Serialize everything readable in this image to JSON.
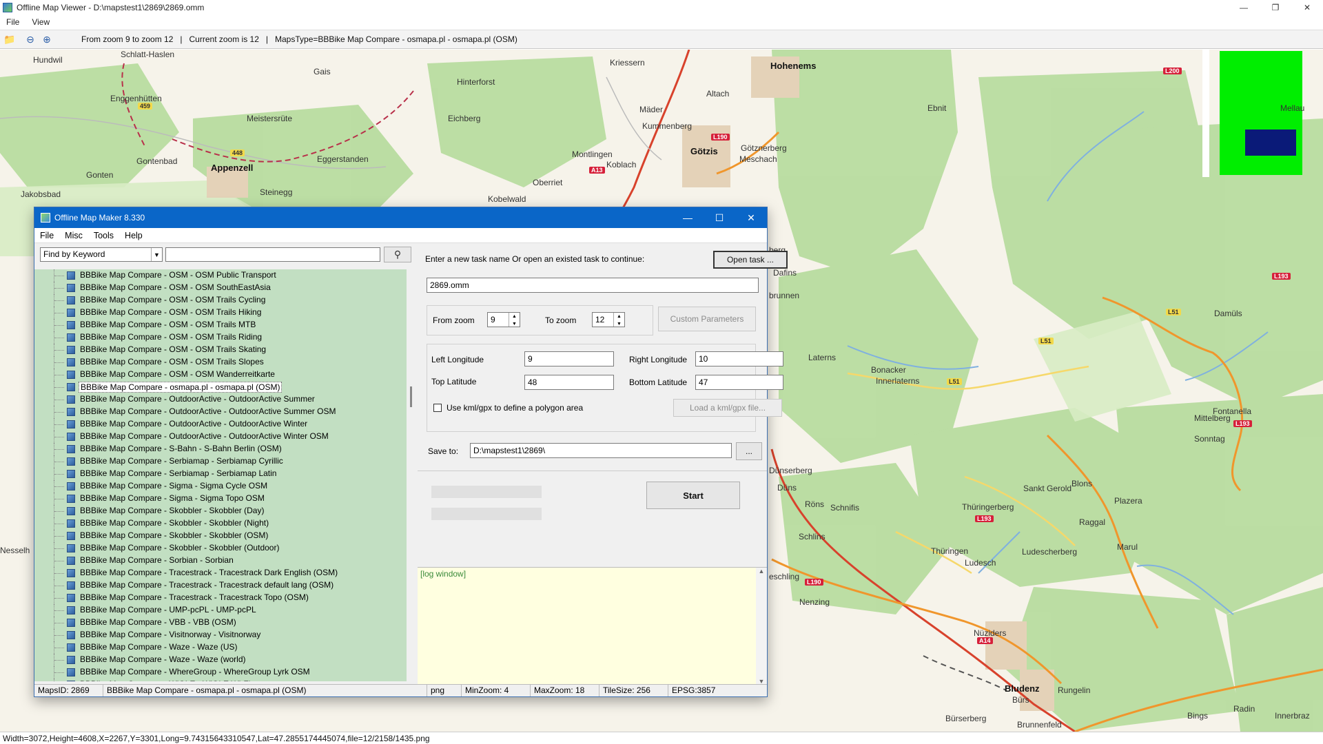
{
  "window": {
    "title": "Offline Map Viewer - D:\\mapstest1\\2869\\2869.omm"
  },
  "menu": [
    "File",
    "View"
  ],
  "toolbar": {
    "zoom_range": "From zoom 9 to zoom 12",
    "current_zoom": "Current zoom is 12",
    "maps_type": "MapsType=BBBike Map Compare - osmapa.pl - osmapa.pl (OSM)"
  },
  "map": {
    "places": [
      {
        "name": "Hundwil",
        "kind": "village"
      },
      {
        "name": "Schlatt-Haslen",
        "kind": "village"
      },
      {
        "name": "Gais",
        "kind": "village"
      },
      {
        "name": "Hinterforst",
        "kind": "village"
      },
      {
        "name": "Kriessern",
        "kind": "village"
      },
      {
        "name": "Hohenems",
        "kind": "town"
      },
      {
        "name": "Enggenhütten",
        "kind": "village"
      },
      {
        "name": "Meistersrüte",
        "kind": "village"
      },
      {
        "name": "Eichberg",
        "kind": "village"
      },
      {
        "name": "Altach",
        "kind": "village"
      },
      {
        "name": "Mäder",
        "kind": "village"
      },
      {
        "name": "Kummenberg",
        "kind": "village"
      },
      {
        "name": "Ebnit",
        "kind": "village"
      },
      {
        "name": "Mellau",
        "kind": "village"
      },
      {
        "name": "Gontenbad",
        "kind": "village"
      },
      {
        "name": "Eggerstanden",
        "kind": "village"
      },
      {
        "name": "Appenzell",
        "kind": "town"
      },
      {
        "name": "Montlingen",
        "kind": "village"
      },
      {
        "name": "Koblach",
        "kind": "village"
      },
      {
        "name": "Götzis",
        "kind": "town"
      },
      {
        "name": "Götznerberg",
        "kind": "village"
      },
      {
        "name": "Meschach",
        "kind": "village"
      },
      {
        "name": "Gonten",
        "kind": "village"
      },
      {
        "name": "Jakobsbad",
        "kind": "village"
      },
      {
        "name": "Steinegg",
        "kind": "village"
      },
      {
        "name": "Oberriet",
        "kind": "village"
      },
      {
        "name": "Kobelwald",
        "kind": "village"
      },
      {
        "name": "Dafins",
        "kind": "village"
      },
      {
        "name": "Laterns",
        "kind": "village"
      },
      {
        "name": "Bonacker",
        "kind": "village"
      },
      {
        "name": "Innerlaterns",
        "kind": "village"
      },
      {
        "name": "Damüls",
        "kind": "village"
      },
      {
        "name": "Fontanella",
        "kind": "village"
      },
      {
        "name": "Mittelberg",
        "kind": "village"
      },
      {
        "name": "Sonntag",
        "kind": "village"
      },
      {
        "name": "Dünserberg",
        "kind": "village"
      },
      {
        "name": "Düns",
        "kind": "village"
      },
      {
        "name": "Sankt Gerold",
        "kind": "village"
      },
      {
        "name": "Blons",
        "kind": "village"
      },
      {
        "name": "Röns",
        "kind": "village"
      },
      {
        "name": "Schnifis",
        "kind": "village"
      },
      {
        "name": "Thüringerberg",
        "kind": "village"
      },
      {
        "name": "Plazera",
        "kind": "village"
      },
      {
        "name": "Raggal",
        "kind": "village"
      },
      {
        "name": "Schlins",
        "kind": "village"
      },
      {
        "name": "Thüringen",
        "kind": "village"
      },
      {
        "name": "Ludesch",
        "kind": "village"
      },
      {
        "name": "Ludescherberg",
        "kind": "village"
      },
      {
        "name": "Marul",
        "kind": "village"
      },
      {
        "name": "Nenzing",
        "kind": "village"
      },
      {
        "name": "Nüziders",
        "kind": "village"
      },
      {
        "name": "Bludenz",
        "kind": "town"
      },
      {
        "name": "Bürs",
        "kind": "village"
      },
      {
        "name": "Rungelin",
        "kind": "village"
      },
      {
        "name": "Bings",
        "kind": "village"
      },
      {
        "name": "Radin",
        "kind": "village"
      },
      {
        "name": "Innerbraz",
        "kind": "village"
      },
      {
        "name": "Bürserberg",
        "kind": "village"
      },
      {
        "name": "Brunnenfeld",
        "kind": "village"
      },
      {
        "name": "Nesselh",
        "kind": "village"
      },
      {
        "name": "brunnen",
        "kind": "village"
      },
      {
        "name": "berg",
        "kind": "village"
      },
      {
        "name": "eschling",
        "kind": "village"
      }
    ],
    "road_badges": [
      "L200",
      "459",
      "448",
      "L190",
      "A13",
      "L193",
      "L51",
      "L51",
      "L51",
      "L193",
      "L193",
      "L190",
      "A14"
    ]
  },
  "status_main": "Width=3072,Height=4608,X=2267,Y=3301,Long=9.74315643310547,Lat=47.2855174445074,file=12/2158/1435.png",
  "dialog": {
    "title": "Offline Map Maker 8.330",
    "menu": [
      "File",
      "Misc",
      "Tools",
      "Help"
    ],
    "find_mode": "Find by Keyword",
    "find_value": "",
    "tree_items": [
      "BBBike Map Compare - OSM - OSM Public Transport",
      "BBBike Map Compare - OSM - OSM SouthEastAsia",
      "BBBike Map Compare - OSM - OSM Trails Cycling",
      "BBBike Map Compare - OSM - OSM Trails Hiking",
      "BBBike Map Compare - OSM - OSM Trails MTB",
      "BBBike Map Compare - OSM - OSM Trails Riding",
      "BBBike Map Compare - OSM - OSM Trails Skating",
      "BBBike Map Compare - OSM - OSM Trails Slopes",
      "BBBike Map Compare - OSM - OSM Wanderreitkarte",
      "BBBike Map Compare - osmapa.pl - osmapa.pl (OSM)",
      "BBBike Map Compare - OutdoorActive - OutdoorActive Summer",
      "BBBike Map Compare - OutdoorActive - OutdoorActive Summer OSM",
      "BBBike Map Compare - OutdoorActive - OutdoorActive Winter",
      "BBBike Map Compare - OutdoorActive - OutdoorActive Winter OSM",
      "BBBike Map Compare - S-Bahn - S-Bahn Berlin (OSM)",
      "BBBike Map Compare - Serbiamap - Serbiamap Cyrillic",
      "BBBike Map Compare - Serbiamap - Serbiamap Latin",
      "BBBike Map Compare - Sigma - Sigma Cycle OSM",
      "BBBike Map Compare - Sigma - Sigma Topo OSM",
      "BBBike Map Compare - Skobbler - Skobbler (Day)",
      "BBBike Map Compare - Skobbler - Skobbler (Night)",
      "BBBike Map Compare - Skobbler - Skobbler (OSM)",
      "BBBike Map Compare - Skobbler - Skobbler (Outdoor)",
      "BBBike Map Compare - Sorbian - Sorbian",
      "BBBike Map Compare - Tracestrack - Tracestrack Dark English (OSM)",
      "BBBike Map Compare - Tracestrack - Tracestrack default lang (OSM)",
      "BBBike Map Compare - Tracestrack - Tracestrack Topo (OSM)",
      "BBBike Map Compare - UMP-pcPL - UMP-pcPL",
      "BBBike Map Compare - VBB - VBB (OSM)",
      "BBBike Map Compare - Visitnorway - Visitnorway",
      "BBBike Map Compare - Waze - Waze (US)",
      "BBBike Map Compare - Waze - Waze (world)",
      "BBBike Map Compare - WhereGroup - WhereGroup Lyrk OSM",
      "BBBike Map Compare - WiGLE - WiGLE Wi-Fi"
    ],
    "selected_index": 9,
    "prompt": "Enter a new task name Or open an existed task to continue:",
    "open_task_label": "Open task ...",
    "task_name": "2869.omm",
    "from_zoom_label": "From zoom",
    "from_zoom": "9",
    "to_zoom_label": "To zoom",
    "to_zoom": "12",
    "custom_params_label": "Custom Parameters",
    "left_lon_label": "Left Longitude",
    "left_lon": "9",
    "right_lon_label": "Right Longitude",
    "right_lon": "10",
    "top_lat_label": "Top Latitude",
    "top_lat": "48",
    "bottom_lat_label": "Bottom Latitude",
    "bottom_lat": "47",
    "kml_label": "Use kml/gpx to define a polygon area",
    "load_kml_label": "Load a kml/gpx file...",
    "save_to_label": "Save to:",
    "save_to": "D:\\mapstest1\\2869\\",
    "browse_label": "...",
    "start_label": "Start",
    "log_text": "[log window]",
    "status": [
      "MapsID: 2869",
      "BBBike Map Compare - osmapa.pl - osmapa.pl (OSM)",
      "png",
      "MinZoom: 4",
      "MaxZoom: 18",
      "TileSize: 256",
      "EPSG:3857"
    ]
  }
}
